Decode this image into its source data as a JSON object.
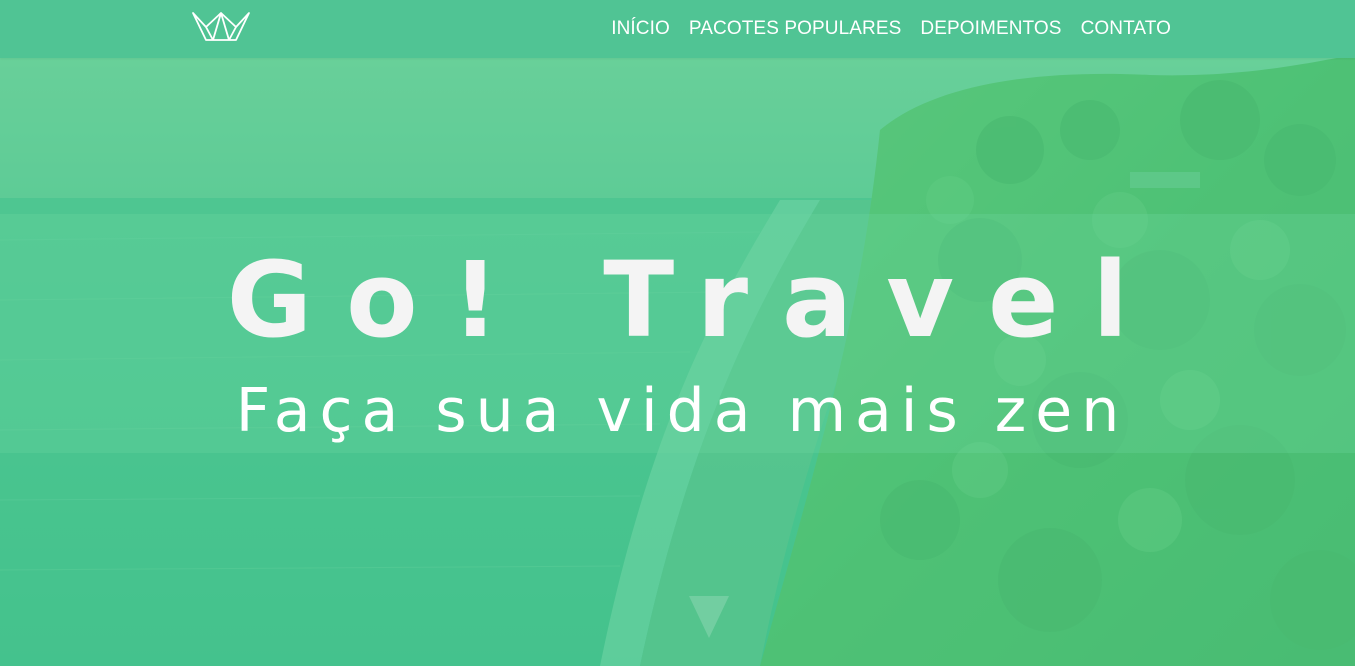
{
  "nav": {
    "logo_icon": "crown-icon",
    "links": [
      {
        "label": "INÍCIO"
      },
      {
        "label": "PACOTES POPULARES"
      },
      {
        "label": "DEPOIMENTOS"
      },
      {
        "label": "CONTATO"
      }
    ]
  },
  "hero": {
    "title": "Go! Travel",
    "subtitle": "Faça sua vida mais zen",
    "scroll_icon": "triangle-down-icon"
  },
  "colors": {
    "navbar": "#50c494",
    "overlay": "#48c88c",
    "text": "#ffffff"
  }
}
